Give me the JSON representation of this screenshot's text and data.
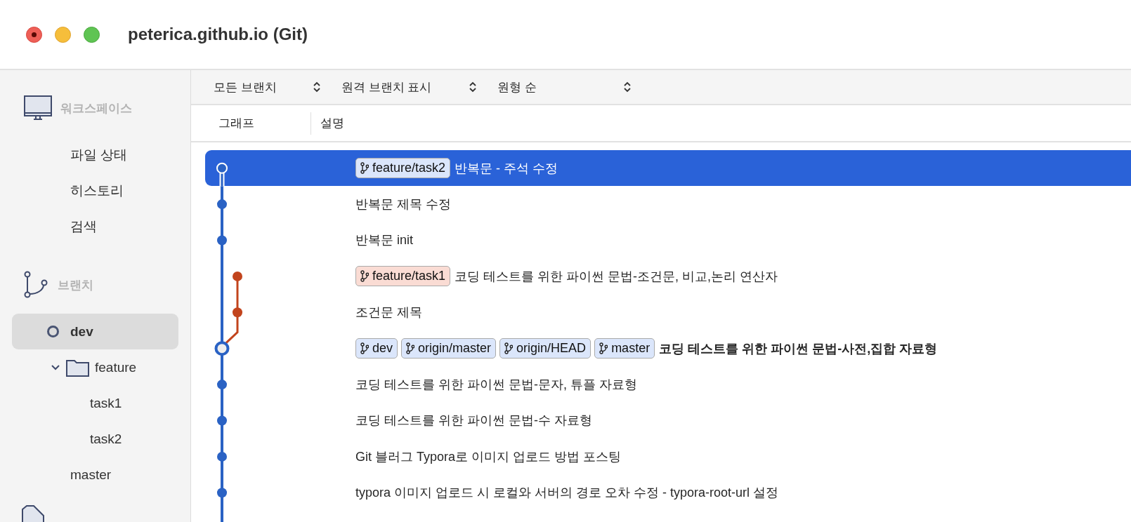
{
  "window": {
    "title": "peterica.github.io (Git)"
  },
  "sidebar": {
    "sections": [
      {
        "kind": "workspace",
        "title": "워크스페이스",
        "items": [
          {
            "label": "파일 상태",
            "selected": false
          },
          {
            "label": "히스토리",
            "selected": false
          },
          {
            "label": "검색",
            "selected": false
          }
        ]
      },
      {
        "kind": "branches",
        "title": "브랜치",
        "items": [
          {
            "label": "dev",
            "kind": "branch",
            "selected": true,
            "current": true
          },
          {
            "label": "feature",
            "kind": "folder",
            "expanded": true,
            "selected": false,
            "children": [
              {
                "label": "task1",
                "selected": false,
                "current": false
              },
              {
                "label": "task2",
                "selected": false,
                "current": false
              }
            ]
          },
          {
            "label": "master",
            "kind": "branch",
            "selected": false,
            "current": false
          }
        ]
      }
    ]
  },
  "toolbar": {
    "dropdowns": [
      {
        "value": "모든 브랜치"
      },
      {
        "value": "원격 브랜치 표시"
      },
      {
        "value": "원형 순"
      }
    ]
  },
  "table": {
    "columns": [
      "그래프",
      "설명"
    ],
    "rows": [
      {
        "selected": true,
        "current": false,
        "kind": "tip",
        "tags": [
          {
            "label": "feature/task2",
            "color": "#dbe6fb"
          }
        ],
        "message": "반복문 - 주석 수정"
      },
      {
        "selected": false,
        "current": false,
        "kind": "commit",
        "tags": [],
        "message": "반복문 제목 수정"
      },
      {
        "selected": false,
        "current": false,
        "kind": "commit",
        "tags": [],
        "message": "반복문 init"
      },
      {
        "selected": false,
        "current": false,
        "kind": "branch",
        "tags": [
          {
            "label": "feature/task1",
            "color": "#fadcd4"
          }
        ],
        "message": "코딩 테스트를 위한 파이썬 문법-조건문, 비교,논리 연산자"
      },
      {
        "selected": false,
        "current": false,
        "kind": "branch",
        "tags": [],
        "message": "조건문 제목"
      },
      {
        "selected": false,
        "current": true,
        "kind": "head",
        "tags": [
          {
            "label": "dev",
            "color": "#dbe6fb"
          },
          {
            "label": "origin/master",
            "color": "#dbe6fb"
          },
          {
            "label": "origin/HEAD",
            "color": "#dbe6fb"
          },
          {
            "label": "master",
            "color": "#dbe6fb"
          }
        ],
        "message": "코딩 테스트를 위한 파이썬 문법-사전,집합 자료형"
      },
      {
        "selected": false,
        "current": false,
        "kind": "commit",
        "tags": [],
        "message": "코딩 테스트를 위한 파이썬 문법-문자, 튜플 자료형"
      },
      {
        "selected": false,
        "current": false,
        "kind": "commit",
        "tags": [],
        "message": "코딩 테스트를 위한 파이썬 문법-수 자료형"
      },
      {
        "selected": false,
        "current": false,
        "kind": "commit",
        "tags": [],
        "message": "Git 블러그 Typora로 이미지 업로드 방법 포스팅"
      },
      {
        "selected": false,
        "current": false,
        "kind": "commit",
        "tags": [],
        "message": "typora 이미지 업로드 시 로컬와 서버의 경로 오차 수정 - typora-root-url 설정"
      }
    ]
  }
}
